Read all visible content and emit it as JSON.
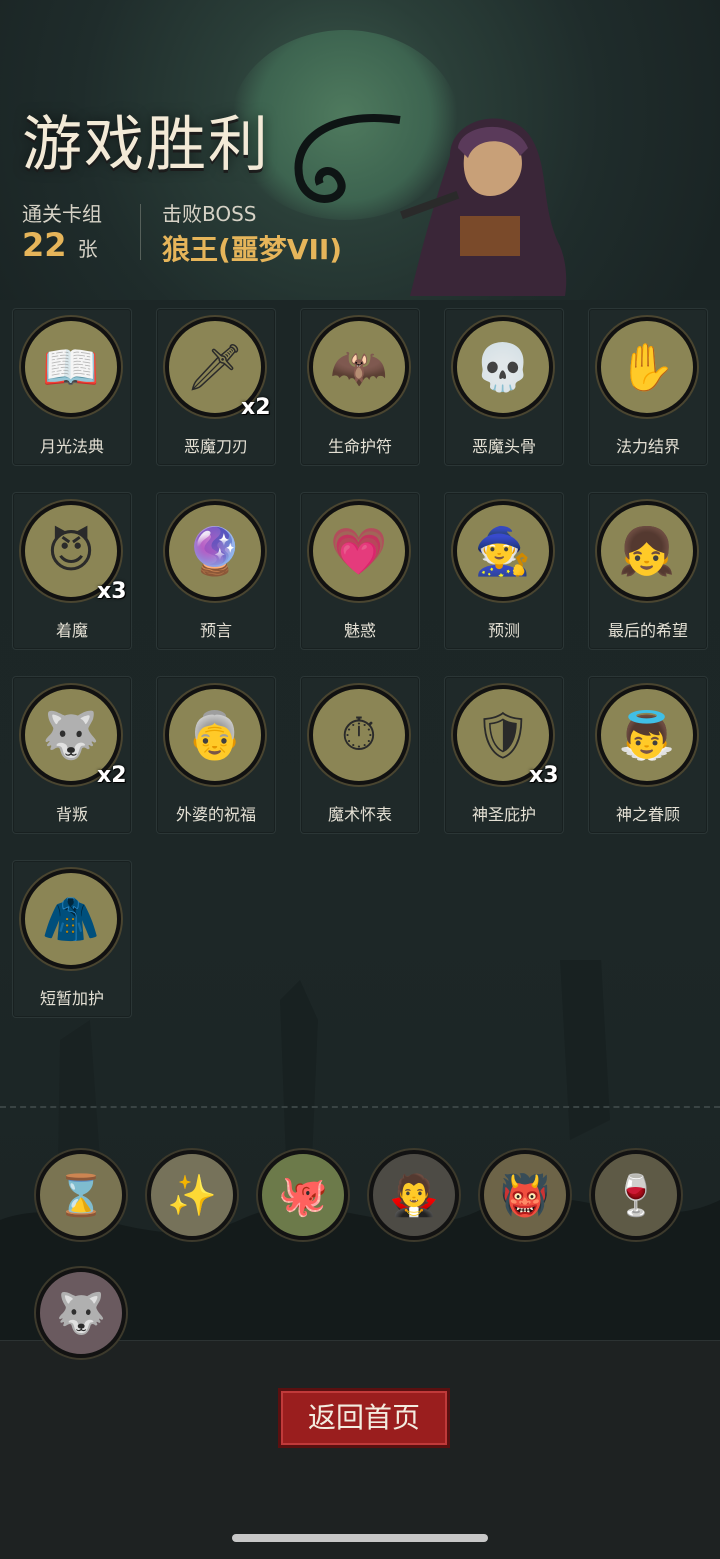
{
  "header": {
    "title": "游戏胜利",
    "deck_label": "通关卡组",
    "deck_count": "22",
    "deck_unit": "张",
    "boss_label": "击败BOSS",
    "boss_name": "狼王(噩梦VII)"
  },
  "cards": [
    {
      "name": "月光法典",
      "icon": "book-icon",
      "glyph": "📖",
      "count": ""
    },
    {
      "name": "恶魔刀刃",
      "icon": "blade-icon",
      "glyph": "🗡",
      "count": "x2"
    },
    {
      "name": "生命护符",
      "icon": "bat-icon",
      "glyph": "🦇",
      "count": ""
    },
    {
      "name": "恶魔头骨",
      "icon": "skull-icon",
      "glyph": "💀",
      "count": ""
    },
    {
      "name": "法力结界",
      "icon": "barrier-icon",
      "glyph": "✋",
      "count": ""
    },
    {
      "name": "着魔",
      "icon": "possessed-icon",
      "glyph": "😈",
      "count": "x3"
    },
    {
      "name": "预言",
      "icon": "prophet-icon",
      "glyph": "🔮",
      "count": ""
    },
    {
      "name": "魅惑",
      "icon": "charm-icon",
      "glyph": "💗",
      "count": ""
    },
    {
      "name": "预测",
      "icon": "witch-icon",
      "glyph": "🧙",
      "count": ""
    },
    {
      "name": "最后的希望",
      "icon": "girl-icon",
      "glyph": "👧",
      "count": ""
    },
    {
      "name": "背叛",
      "icon": "betrayal-icon",
      "glyph": "🐺",
      "count": "x2"
    },
    {
      "name": "外婆的祝福",
      "icon": "grandma-icon",
      "glyph": "👵",
      "count": ""
    },
    {
      "name": "魔术怀表",
      "icon": "pocket-watch-icon",
      "glyph": "⏱",
      "count": ""
    },
    {
      "name": "神圣庇护",
      "icon": "holy-shield-icon",
      "glyph": "🛡",
      "count": "x3"
    },
    {
      "name": "神之眷顾",
      "icon": "angel-icon",
      "glyph": "👼",
      "count": ""
    },
    {
      "name": "短暂加护",
      "icon": "hooded-mage-icon",
      "glyph": "🧥",
      "count": ""
    }
  ],
  "relics": [
    {
      "icon": "hourglass-icon",
      "glyph": "⌛",
      "color": "#7a7452"
    },
    {
      "icon": "spirit-book-icon",
      "glyph": "✨",
      "color": "#76725a"
    },
    {
      "icon": "tentacle-icon",
      "glyph": "🐙",
      "color": "#6c7a4a"
    },
    {
      "icon": "vampire-icon",
      "glyph": "🧛",
      "color": "#4d4b45"
    },
    {
      "icon": "red-demon-icon",
      "glyph": "👹",
      "color": "#6d6448"
    },
    {
      "icon": "dracula-icon",
      "glyph": "🍷",
      "color": "#5e5a46"
    },
    {
      "icon": "werewolf-icon",
      "glyph": "🐺",
      "color": "#6a5a5f"
    }
  ],
  "footer": {
    "home_button": "返回首页"
  }
}
